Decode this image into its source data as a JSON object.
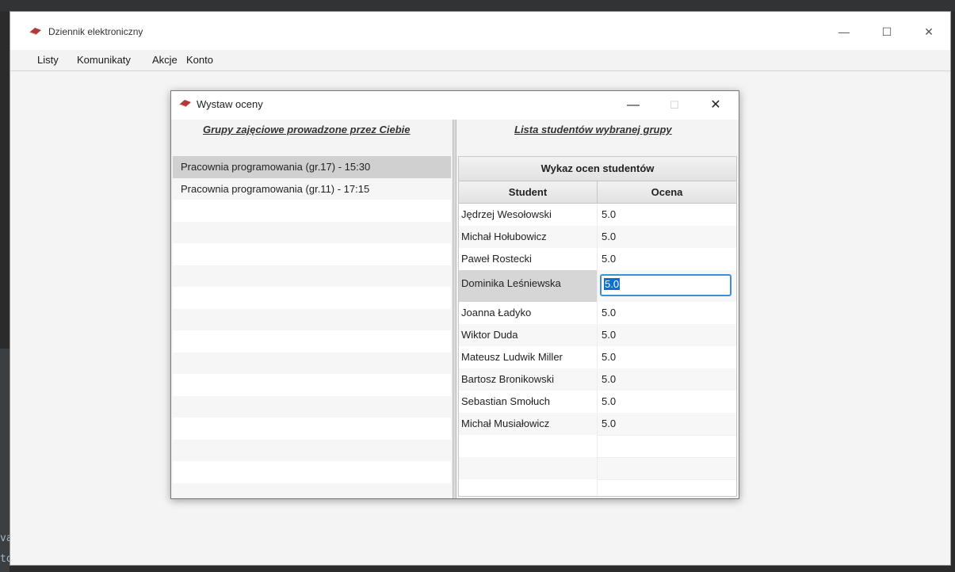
{
  "main_window": {
    "title": "Dziennik elektroniczny",
    "controls": {
      "minimize": "—",
      "maximize": "☐",
      "close": "✕"
    },
    "menu": [
      "Listy",
      "Komunikaty",
      "Akcje",
      "Konto"
    ]
  },
  "dialog": {
    "title": "Wystaw oceny",
    "controls": {
      "minimize": "—",
      "maximize": "☐",
      "close": "✕"
    },
    "left_heading": "Grupy zajęciowe prowadzone przez Ciebie",
    "right_heading": "Lista studentów wybranej grupy",
    "groups": [
      "Pracownia programowania (gr.17) - 15:30",
      "Pracownia programowania (gr.11) - 17:15"
    ],
    "selected_group_index": 0,
    "table": {
      "title": "Wykaz ocen studentów",
      "columns": [
        "Student",
        "Ocena"
      ],
      "rows": [
        {
          "student": "Jędrzej Wesołowski",
          "grade": "5.0"
        },
        {
          "student": "Michał Hołubowicz",
          "grade": "5.0"
        },
        {
          "student": "Paweł Rostecki",
          "grade": "5.0"
        },
        {
          "student": "Dominika Leśniewska",
          "grade": "5.0"
        },
        {
          "student": "Joanna Ładyko",
          "grade": "5.0"
        },
        {
          "student": "Wiktor Duda",
          "grade": "5.0"
        },
        {
          "student": "Mateusz Ludwik Miller",
          "grade": "5.0"
        },
        {
          "student": "Bartosz Bronikowski",
          "grade": "5.0"
        },
        {
          "student": "Sebastian Smołuch",
          "grade": "5.0"
        },
        {
          "student": "Michał Musiałowicz",
          "grade": "5.0"
        }
      ],
      "editing_row_index": 3
    }
  },
  "background": {
    "code_lines": [
      "va",
      "to"
    ]
  },
  "colors": {
    "selection": "#0f6fd0",
    "edit_border": "#3a8fd6",
    "ide_background": "#2b2b2b"
  }
}
